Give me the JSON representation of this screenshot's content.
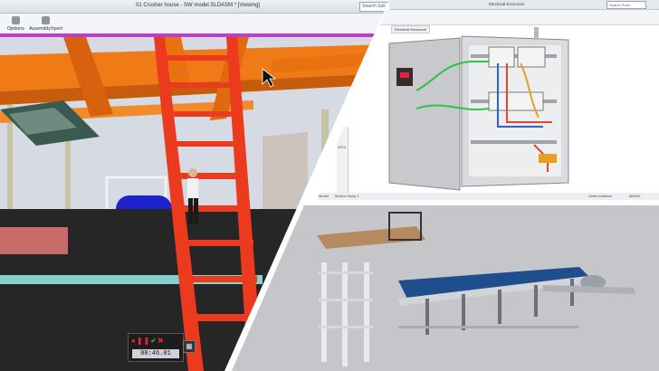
{
  "left_window": {
    "title": "01 Crusher house - SW model.SLDASM * [Viewing]",
    "search_label": "Search Soli",
    "ribbon": [
      {
        "label": "Options",
        "icon": "options-icon"
      },
      {
        "label": "AssemblyXpert",
        "icon": "assemblyxpert-icon"
      }
    ],
    "recorder": {
      "controls": [
        "record",
        "pause",
        "play",
        "stop"
      ],
      "time": "00:46.01"
    }
  },
  "electrical_window": {
    "title": "Electrical Enclosure",
    "search_label": "Search Solid",
    "tab_label": "Electrical Enclosure",
    "side_label": "2374",
    "status_tabs": [
      "Model",
      "Motion Study 1"
    ],
    "status_right": "Under Defined",
    "status_units": "MMGS"
  },
  "colors": {
    "beam_orange": "#f07a16",
    "ladder_red": "#ec3a1e",
    "magenta_strip": "#c23bd0",
    "wire_green": "#2fc246",
    "wire_blue": "#2a5fe0",
    "conveyor_blue": "#1e4f8c"
  }
}
